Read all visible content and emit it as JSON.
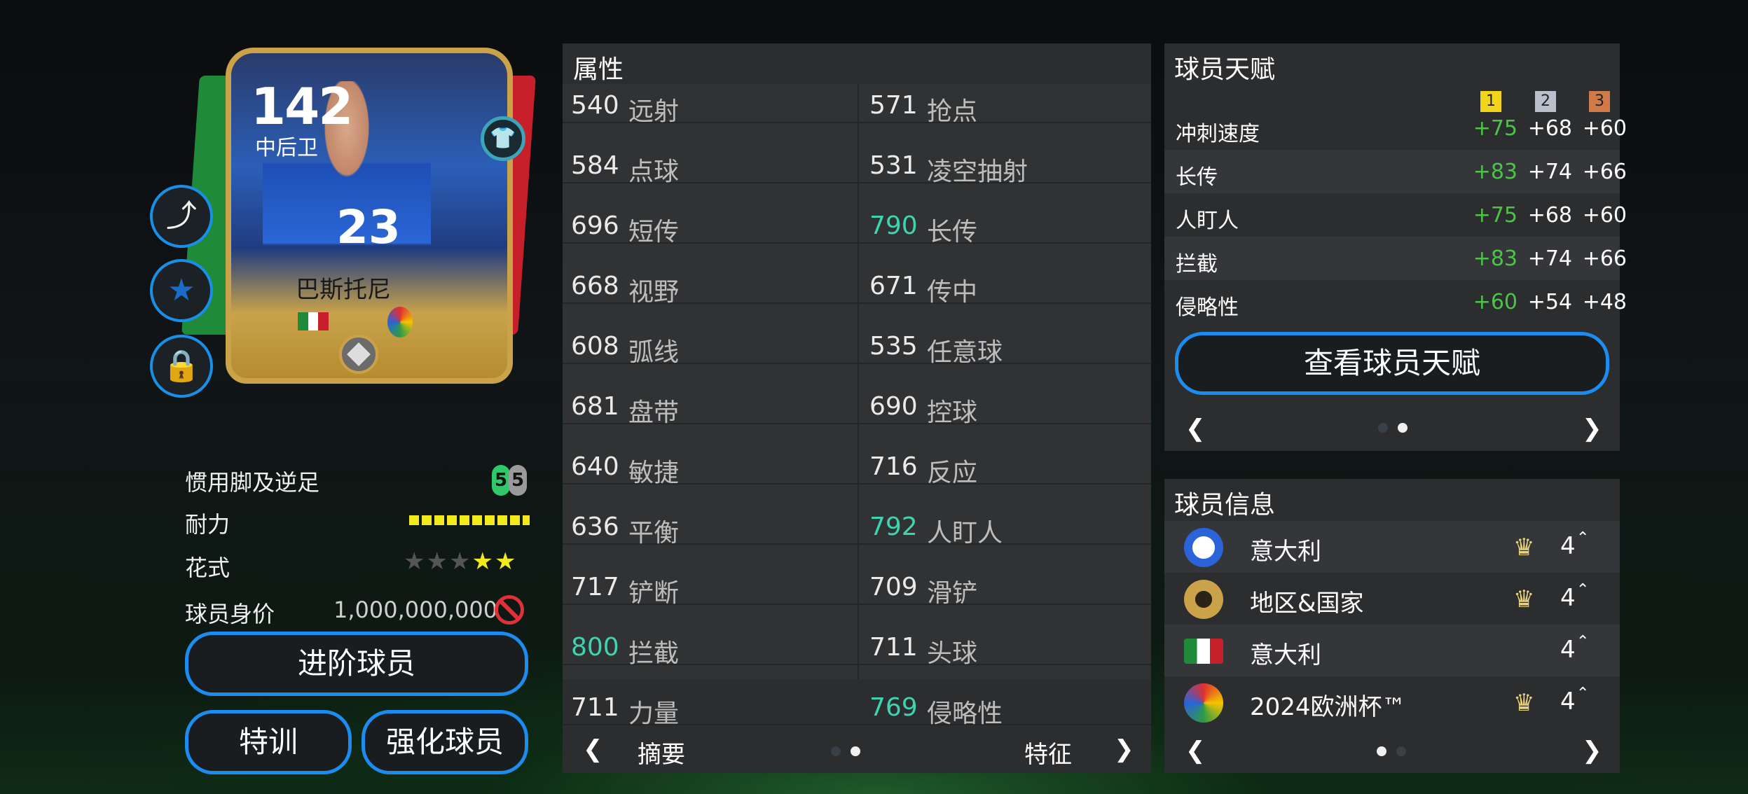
{
  "card": {
    "ovr": "142",
    "position": "中后卫",
    "name": "巴斯托尼",
    "jersey": "23"
  },
  "left": {
    "foot_label": "惯用脚及逆足",
    "foot_left": "5",
    "foot_right": "5",
    "stamina_label": "耐力",
    "skill_label": "花式",
    "skill_stars": 2,
    "value_label": "球员身价",
    "value": "1,000,000,000",
    "btn_advance": "进阶球员",
    "btn_train": "特训",
    "btn_boost": "强化球员"
  },
  "attrs": {
    "title": "属性",
    "rows": [
      {
        "l_num": "540",
        "l_lab": "远射",
        "r_num": "571",
        "r_lab": "抢点",
        "l_hi": false,
        "r_hi": false
      },
      {
        "l_num": "584",
        "l_lab": "点球",
        "r_num": "531",
        "r_lab": "凌空抽射",
        "l_hi": false,
        "r_hi": false
      },
      {
        "l_num": "696",
        "l_lab": "短传",
        "r_num": "790",
        "r_lab": "长传",
        "l_hi": false,
        "r_hi": true
      },
      {
        "l_num": "668",
        "l_lab": "视野",
        "r_num": "671",
        "r_lab": "传中",
        "l_hi": false,
        "r_hi": false
      },
      {
        "l_num": "608",
        "l_lab": "弧线",
        "r_num": "535",
        "r_lab": "任意球",
        "l_hi": false,
        "r_hi": false
      },
      {
        "l_num": "681",
        "l_lab": "盘带",
        "r_num": "690",
        "r_lab": "控球",
        "l_hi": false,
        "r_hi": false
      },
      {
        "l_num": "640",
        "l_lab": "敏捷",
        "r_num": "716",
        "r_lab": "反应",
        "l_hi": false,
        "r_hi": false
      },
      {
        "l_num": "636",
        "l_lab": "平衡",
        "r_num": "792",
        "r_lab": "人盯人",
        "l_hi": false,
        "r_hi": true
      },
      {
        "l_num": "717",
        "l_lab": "铲断",
        "r_num": "709",
        "r_lab": "滑铲",
        "l_hi": false,
        "r_hi": false
      },
      {
        "l_num": "800",
        "l_lab": "拦截",
        "r_num": "711",
        "r_lab": "头球",
        "l_hi": true,
        "r_hi": false
      },
      {
        "l_num": "711",
        "l_lab": "力量",
        "r_num": "769",
        "r_lab": "侵略性",
        "l_hi": false,
        "r_hi": true
      }
    ],
    "nav_left": "摘要",
    "nav_right": "特征",
    "nav_prev": "❮",
    "nav_next": "❯"
  },
  "talent": {
    "title": "球员天赋",
    "ranks": [
      "1",
      "2",
      "3"
    ],
    "rows": [
      {
        "label": "冲刺速度",
        "v1": "+75",
        "v2": "+68",
        "v3": "+60"
      },
      {
        "label": "长传",
        "v1": "+83",
        "v2": "+74",
        "v3": "+66"
      },
      {
        "label": "人盯人",
        "v1": "+75",
        "v2": "+68",
        "v3": "+60"
      },
      {
        "label": "拦截",
        "v1": "+83",
        "v2": "+74",
        "v3": "+66"
      },
      {
        "label": "侵略性",
        "v1": "+60",
        "v2": "+54",
        "v3": "+48"
      }
    ],
    "button": "查看球员天赋",
    "nav_prev": "❮",
    "nav_next": "❯"
  },
  "info": {
    "title": "球员信息",
    "rows": [
      {
        "label": "意大利",
        "level": "4",
        "crown": true
      },
      {
        "label": "地区&国家",
        "level": "4",
        "crown": true
      },
      {
        "label": "意大利",
        "level": "4",
        "crown": false
      },
      {
        "label": "2024欧洲杯™",
        "level": "4",
        "crown": true
      }
    ],
    "nav_prev": "❮",
    "nav_next": "❯"
  },
  "colors": {
    "accent": "#1c8cf0",
    "teal": "#3fd4b0",
    "green": "#4fc24a",
    "gold": "#c9a24a"
  }
}
